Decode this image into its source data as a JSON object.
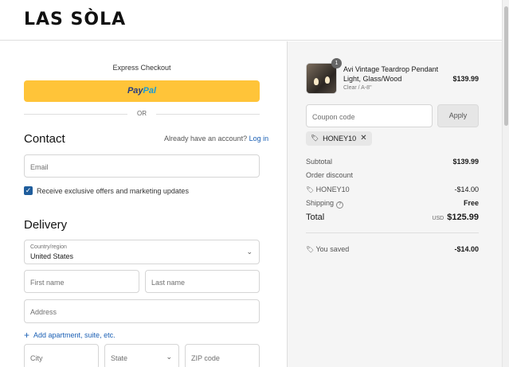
{
  "brand": {
    "logo": "LAS SÒLA"
  },
  "express": {
    "label": "Express Checkout",
    "paypal_part1": "Pay",
    "paypal_part2": "Pal",
    "or": "OR"
  },
  "contact": {
    "title": "Contact",
    "account_prompt": "Already have an account?",
    "login_link": "Log in",
    "email_placeholder": "Email",
    "offers_checked": true,
    "offers_label": "Receive exclusive offers and marketing updates"
  },
  "delivery": {
    "title": "Delivery",
    "country_label": "Country/region",
    "country_value": "United States",
    "first_name_placeholder": "First name",
    "last_name_placeholder": "Last name",
    "address_placeholder": "Address",
    "add_apartment": "Add apartment, suite, etc.",
    "city_placeholder": "City",
    "state_label": "State",
    "zip_placeholder": "ZIP code"
  },
  "cart": {
    "item": {
      "quantity": "1",
      "name": "Avi Vintage Teardrop Pendant Light, Glass/Wood",
      "variant": "Clear / A-8\"",
      "price": "$139.99"
    },
    "coupon_placeholder": "Coupon code",
    "apply_label": "Apply",
    "applied_code": "HONEY10"
  },
  "summary": {
    "subtotal_label": "Subtotal",
    "subtotal_value": "$139.99",
    "order_discount_label": "Order discount",
    "discount_code": "HONEY10",
    "discount_value": "-$14.00",
    "shipping_label": "Shipping",
    "shipping_value": "Free",
    "total_label": "Total",
    "currency": "USD",
    "total_value": "$125.99",
    "saved_label": "You saved",
    "saved_value": "-$14.00"
  },
  "colors": {
    "paypal_yellow": "#ffc439",
    "link_blue": "#1a5fb4",
    "checkbox_blue": "#1f5d9c"
  }
}
